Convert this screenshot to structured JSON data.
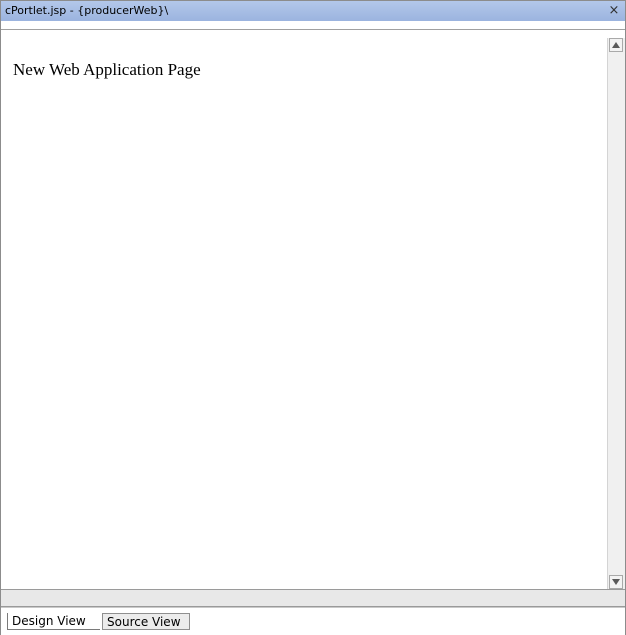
{
  "window": {
    "title": "cPortlet.jsp - {producerWeb}\\",
    "close_glyph": "×"
  },
  "editor": {
    "content_text": "New Web Application Page"
  },
  "tabs": [
    {
      "label": "Design View",
      "selected": true
    },
    {
      "label": "Source View",
      "selected": false
    }
  ],
  "icons": {
    "close": "close-icon",
    "scroll_up": "arrow-up-icon",
    "scroll_down": "arrow-down-icon"
  },
  "colors": {
    "titlebar": "#9bb4df",
    "background": "#ffffff",
    "statusbar": "#e8e8e8"
  }
}
